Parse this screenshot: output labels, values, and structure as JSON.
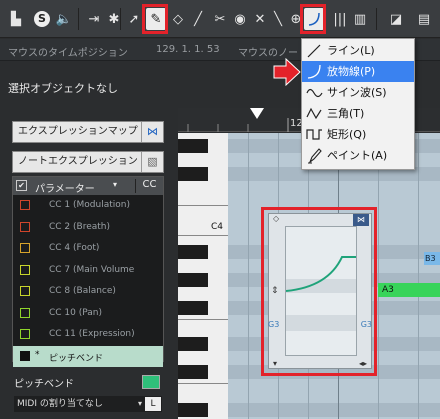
{
  "infobar": {
    "mouse_time_label": "マウスのタイムポジション",
    "mouse_time_value": "129. 1. 1. 53",
    "mouse_note_label": "マウスのノートポ"
  },
  "selection": {
    "label": "選択オブジェクトなし"
  },
  "ruler": {
    "bar_number": "12"
  },
  "inspector": {
    "expression_map_label": "エクスプレッションマップ",
    "note_expression_label": "ノートエクスプレッション",
    "param_header": "パラメーター",
    "param_header_right": "CC",
    "params": [
      {
        "label": "CC 1  (Modulation)",
        "color": "#d0452b"
      },
      {
        "label": "CC 2  (Breath)",
        "color": "#d0452b"
      },
      {
        "label": "CC 4  (Foot)",
        "color": "#d7a32b"
      },
      {
        "label": "CC 7  (Main Volume",
        "color": "#c8d52b"
      },
      {
        "label": "CC 8  (Balance)",
        "color": "#c8d52b"
      },
      {
        "label": "CC 10  (Pan)",
        "color": "#8fd52b"
      },
      {
        "label": "CC 11  (Expression)",
        "color": "#8fd52b"
      },
      {
        "label": "ピッチベンド",
        "color": "#111111"
      }
    ],
    "pitchbend_label": "ピッチベンド",
    "midi_assign_label": "MIDI の割り当てなし"
  },
  "piano": {
    "c4_label": "C4",
    "a3_label": "A3",
    "b3_label": "B3"
  },
  "line_panel": {
    "g3_left": "G3",
    "g3_right": "G3"
  },
  "menu": {
    "items": [
      {
        "label": "ライン(L)",
        "icon": "line-icon"
      },
      {
        "label": "放物線(P)",
        "icon": "parabola-icon"
      },
      {
        "label": "サイン波(S)",
        "icon": "sine-icon"
      },
      {
        "label": "三角(T)",
        "icon": "triangle-icon"
      },
      {
        "label": "矩形(Q)",
        "icon": "square-wave-icon"
      },
      {
        "label": "ペイント(A)",
        "icon": "paint-icon"
      }
    ]
  },
  "colors": {
    "accent": "#3a82f0",
    "highlight": "#e3222a",
    "note": "#38d45a"
  }
}
